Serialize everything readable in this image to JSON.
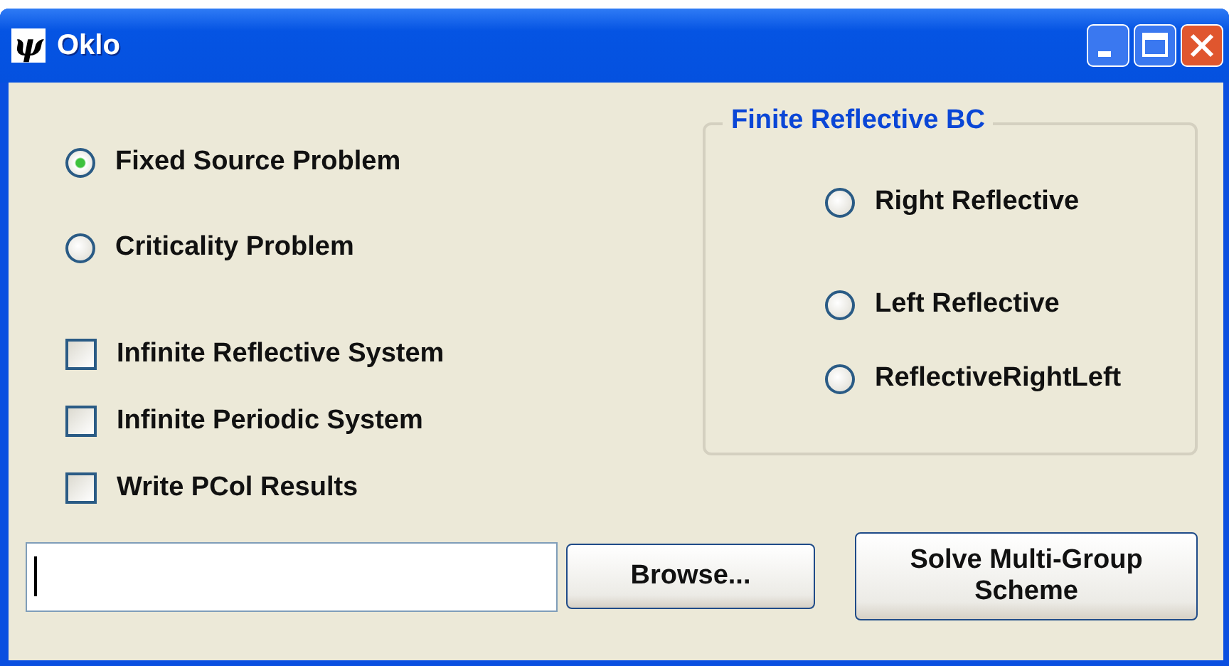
{
  "window": {
    "title": "Oklo",
    "icon_glyph": "ψ"
  },
  "problem_options": [
    {
      "label": "Fixed Source Problem",
      "selected": true
    },
    {
      "label": "Criticality Problem",
      "selected": false
    }
  ],
  "checkboxes": [
    {
      "label": "Infinite Reflective System",
      "checked": false
    },
    {
      "label": "Infinite Periodic System",
      "checked": false
    },
    {
      "label": "Write PCol Results",
      "checked": false
    }
  ],
  "group": {
    "title": "Finite Reflective BC",
    "options": [
      {
        "label": "Right Reflective",
        "selected": false
      },
      {
        "label": "Left Reflective",
        "selected": false
      },
      {
        "label": "ReflectiveRightLeft",
        "selected": false
      }
    ]
  },
  "path_field": {
    "focused": true
  },
  "buttons": [
    {
      "label": "Browse..."
    },
    {
      "label": "Solve Multi-Group Scheme"
    }
  ]
}
